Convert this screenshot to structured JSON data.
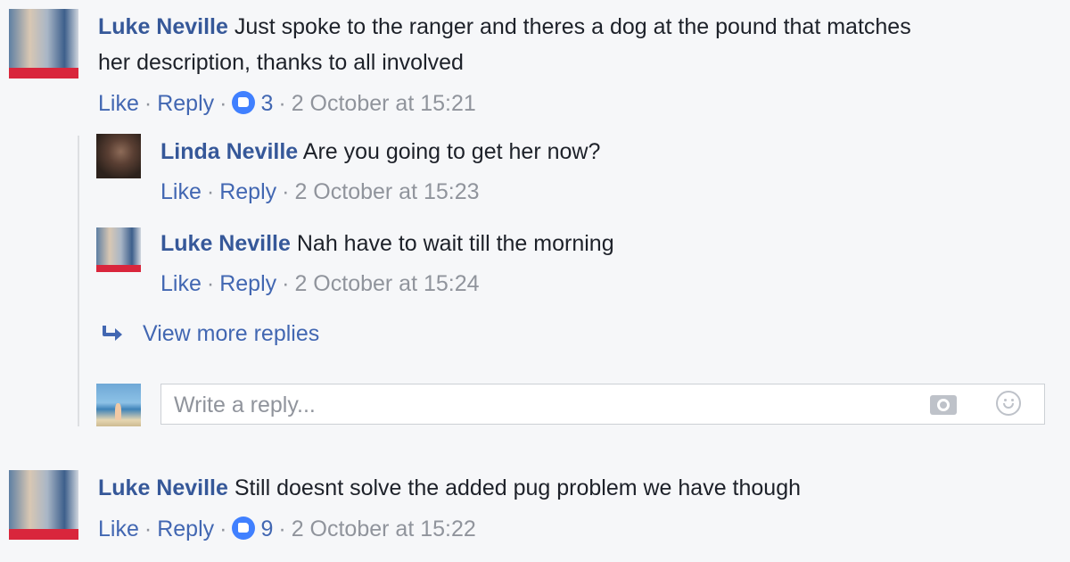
{
  "comments": [
    {
      "author": "Luke Neville",
      "text_line1": "Just spoke to the ranger and theres a dog at the pound that matches",
      "text_line2": "her description, thanks to all involved",
      "like_label": "Like",
      "reply_label": "Reply",
      "reactions": "3",
      "timestamp": "2 October at 15:21",
      "replies": [
        {
          "author": "Linda Neville",
          "text": "Are you going to get her now?",
          "like_label": "Like",
          "reply_label": "Reply",
          "timestamp": "2 October at 15:23"
        },
        {
          "author": "Luke Neville",
          "text": "Nah have to wait till the morning",
          "like_label": "Like",
          "reply_label": "Reply",
          "timestamp": "2 October at 15:24"
        }
      ],
      "view_more_label": "View more replies",
      "reply_placeholder": "Write a reply..."
    },
    {
      "author": "Luke Neville",
      "text": "Still doesnt solve the added pug problem we have though",
      "like_label": "Like",
      "reply_label": "Reply",
      "reactions": "9",
      "timestamp": "2 October at 15:22"
    }
  ],
  "icons": {
    "reaction": "like-thumb-icon",
    "view_more": "reply-arrow-icon",
    "camera": "camera-icon",
    "emoji": "emoji-icon"
  },
  "colors": {
    "author_link": "#365899",
    "action_link": "#4267b2",
    "meta_gray": "#90949c",
    "like_badge": "#4080ff",
    "background": "#f6f7f9"
  }
}
